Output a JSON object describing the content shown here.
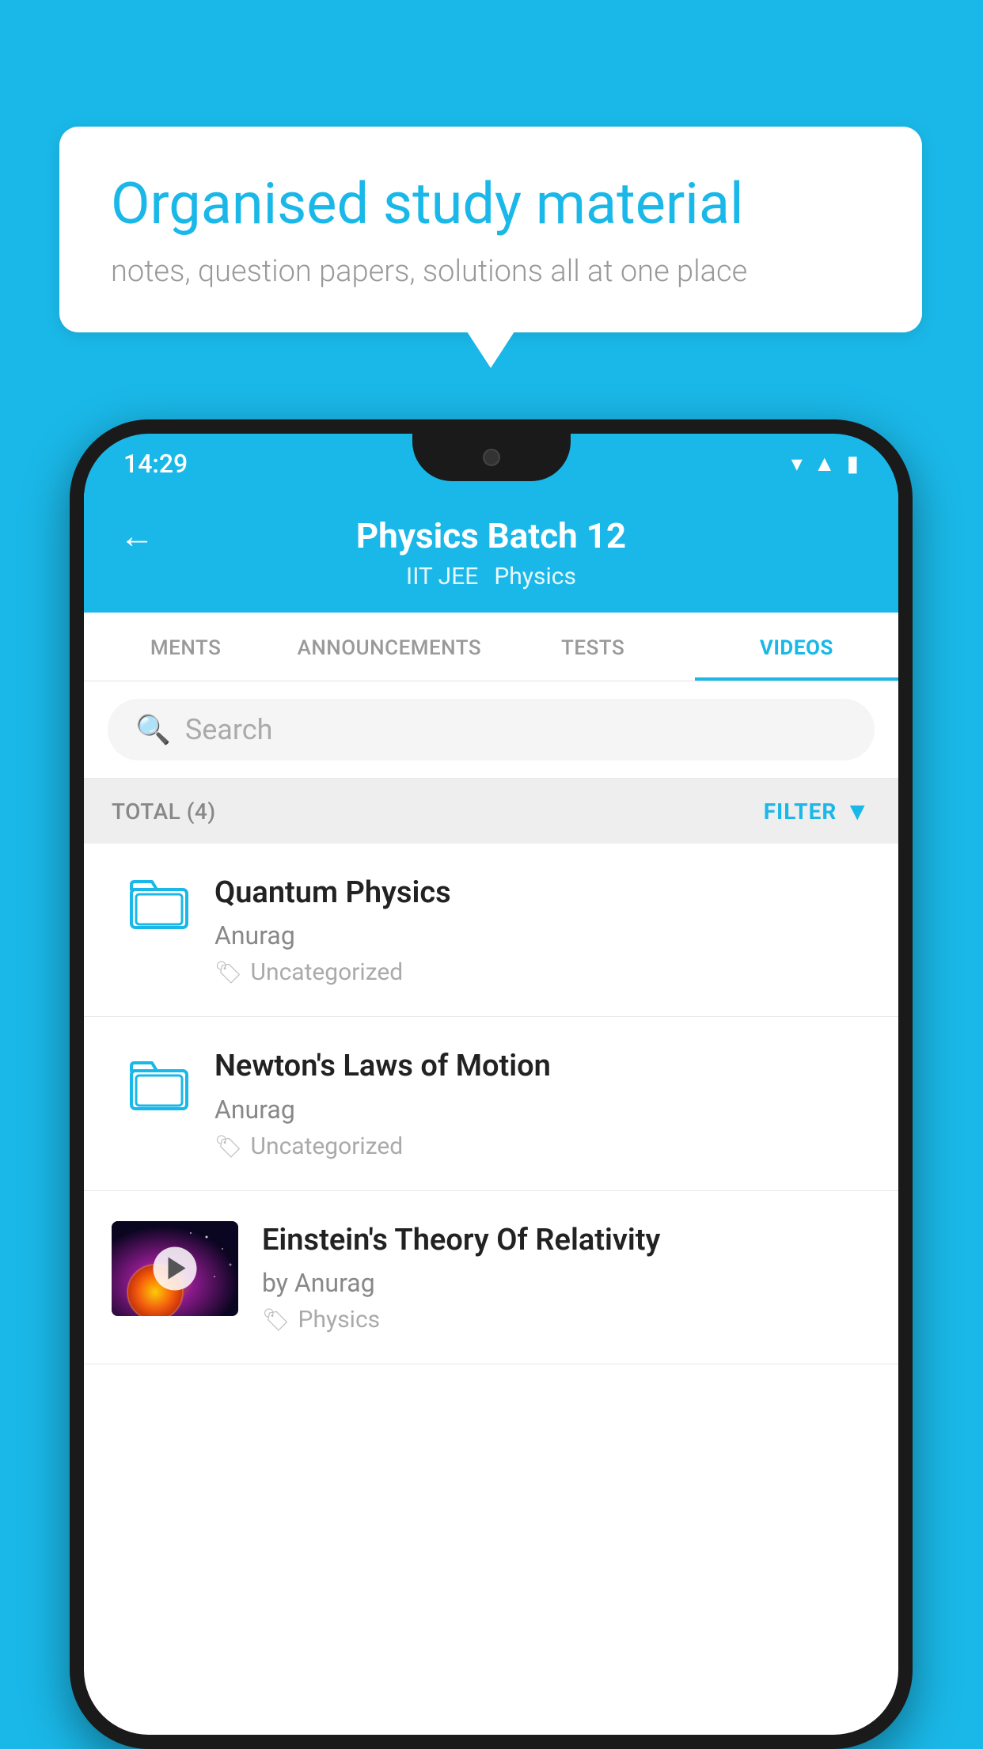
{
  "background_color": "#1ab8e8",
  "bubble": {
    "title": "Organised study material",
    "subtitle": "notes, question papers, solutions all at one place"
  },
  "status_bar": {
    "time": "14:29",
    "wifi": "▾",
    "signal": "▲",
    "battery": "▮"
  },
  "header": {
    "back_label": "←",
    "title": "Physics Batch 12",
    "tag1": "IIT JEE",
    "tag2": "Physics"
  },
  "tabs": [
    {
      "label": "MENTS",
      "active": false
    },
    {
      "label": "ANNOUNCEMENTS",
      "active": false
    },
    {
      "label": "TESTS",
      "active": false
    },
    {
      "label": "VIDEOS",
      "active": true
    }
  ],
  "search": {
    "placeholder": "Search"
  },
  "filter_bar": {
    "total_label": "TOTAL (4)",
    "filter_label": "FILTER"
  },
  "videos": [
    {
      "id": 1,
      "title": "Quantum Physics",
      "author": "Anurag",
      "tag": "Uncategorized",
      "has_thumbnail": false
    },
    {
      "id": 2,
      "title": "Newton's Laws of Motion",
      "author": "Anurag",
      "tag": "Uncategorized",
      "has_thumbnail": false
    },
    {
      "id": 3,
      "title": "Einstein's Theory Of Relativity",
      "author": "by Anurag",
      "tag": "Physics",
      "has_thumbnail": true
    }
  ]
}
